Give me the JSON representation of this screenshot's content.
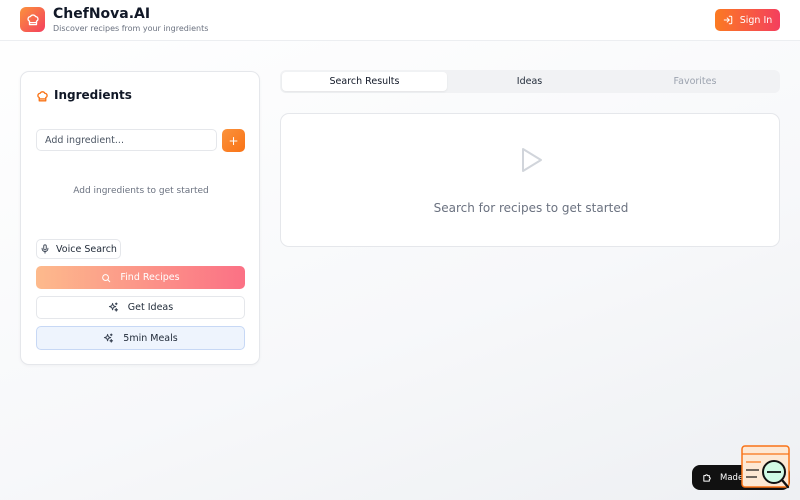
{
  "header": {
    "app_name": "ChefNova.AI",
    "tagline": "Discover recipes from your ingredients",
    "signin_label": "Sign In",
    "logo_icon": "chef-hat-icon"
  },
  "ingredients": {
    "title": "Ingredients",
    "input_placeholder": "Add ingredient...",
    "input_value": "",
    "add_label": "+",
    "empty_message": "Add ingredients to get started",
    "voice_search_label": "Voice Search",
    "find_recipes_label": "Find Recipes",
    "get_ideas_label": "Get Ideas",
    "five_min_label": "5min Meals"
  },
  "tabs": [
    {
      "label": "Search Results",
      "active": true
    },
    {
      "label": "Ideas",
      "active": false
    },
    {
      "label": "Favorites",
      "active": false
    }
  ],
  "results": {
    "empty_message": "Search for recipes to get started"
  },
  "badge": {
    "label": "Made with"
  },
  "colors": {
    "accent_orange": "#f97316",
    "accent_rose": "#f43f5e",
    "light_blue": "#eef4fd"
  }
}
